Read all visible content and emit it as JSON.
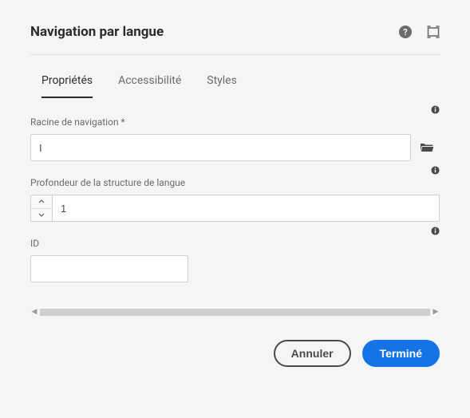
{
  "header": {
    "title": "Navigation par langue"
  },
  "tabs": [
    {
      "label": "Propriétés",
      "active": true
    },
    {
      "label": "Accessibilité",
      "active": false
    },
    {
      "label": "Styles",
      "active": false
    }
  ],
  "fields": {
    "navRoot": {
      "label": "Racine de navigation *",
      "value": "I"
    },
    "structureDepth": {
      "label": "Profondeur de la structure de langue",
      "value": "1"
    },
    "id": {
      "label": "ID",
      "value": ""
    }
  },
  "footer": {
    "cancel": "Annuler",
    "done": "Terminé"
  }
}
